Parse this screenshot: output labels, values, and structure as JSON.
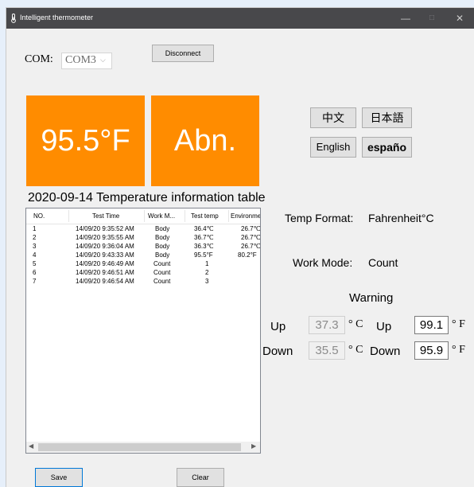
{
  "window": {
    "title": "Intelligent thermometer",
    "controls": {
      "minimize": "—",
      "maximize": "□",
      "close": "✕"
    }
  },
  "com": {
    "label": "COM:",
    "selected": "COM3",
    "disconnect_label": "Disconnect"
  },
  "tiles": {
    "temperature": "95.5°F",
    "status": "Abn."
  },
  "languages": [
    "中文",
    "日本語",
    "English",
    "españo"
  ],
  "table": {
    "title": "2020-09-14 Temperature information table",
    "columns": [
      "NO.",
      "Test Time",
      "Work M...",
      "Test temp",
      "Environme"
    ],
    "rows": [
      [
        "1",
        "14/09/20 9:35:52 AM",
        "Body",
        "36.4℃",
        "26.7℃"
      ],
      [
        "2",
        "14/09/20 9:35:55 AM",
        "Body",
        "36.7℃",
        "26.7℃"
      ],
      [
        "3",
        "14/09/20 9:36:04 AM",
        "Body",
        "36.3℃",
        "26.7℃"
      ],
      [
        "4",
        "14/09/20 9:43:33 AM",
        "Body",
        "95.5°F",
        "80.2°F"
      ],
      [
        "5",
        "14/09/20 9:46:49 AM",
        "Count",
        "1",
        ""
      ],
      [
        "6",
        "14/09/20 9:46:51 AM",
        "Count",
        "2",
        ""
      ],
      [
        "7",
        "14/09/20 9:46:54 AM",
        "Count",
        "3",
        ""
      ]
    ]
  },
  "info": {
    "temp_format_label": "Temp Format:",
    "temp_format_value": "Fahrenheit°C",
    "work_mode_label": "Work Mode:",
    "work_mode_value": "Count"
  },
  "warning": {
    "title": "Warning",
    "up_label": "Up",
    "down_label": "Down",
    "celsius_up": "37.3",
    "celsius_down": "35.5",
    "celsius_unit": "° C",
    "fahrenheit_up": "99.1",
    "fahrenheit_down": "95.9",
    "fahrenheit_unit": "° F"
  },
  "actions": {
    "save_label": "Save",
    "clear_label": "Clear"
  },
  "colors": {
    "tile": "#ff8c00",
    "titlebar": "#48484b",
    "focus": "#0078d7"
  },
  "icons": {
    "app": "thermometer-icon",
    "combo": "chevron-down-icon"
  }
}
